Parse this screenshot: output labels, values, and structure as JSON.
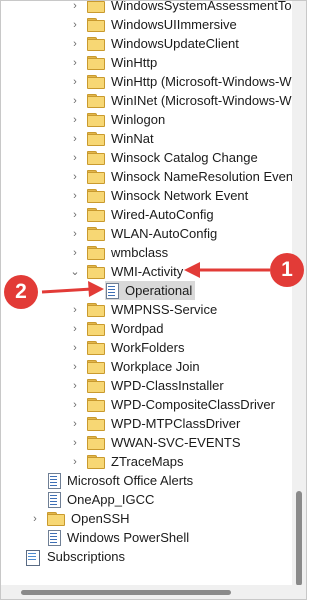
{
  "tree": {
    "items": [
      {
        "label": "WindowsSystemAssessmentTool",
        "icon": "folder-icon"
      },
      {
        "label": "WindowsUIImmersive",
        "icon": "folder-icon"
      },
      {
        "label": "WindowsUpdateClient",
        "icon": "folder-icon"
      },
      {
        "label": "WinHttp",
        "icon": "folder-icon"
      },
      {
        "label": "WinHttp (Microsoft-Windows-W",
        "icon": "folder-icon"
      },
      {
        "label": "WinINet (Microsoft-Windows-W",
        "icon": "folder-icon"
      },
      {
        "label": "Winlogon",
        "icon": "folder-icon"
      },
      {
        "label": "WinNat",
        "icon": "folder-icon"
      },
      {
        "label": "Winsock Catalog Change",
        "icon": "folder-icon"
      },
      {
        "label": "Winsock NameResolution Event",
        "icon": "folder-icon"
      },
      {
        "label": "Winsock Network Event",
        "icon": "folder-icon"
      },
      {
        "label": "Wired-AutoConfig",
        "icon": "folder-icon"
      },
      {
        "label": "WLAN-AutoConfig",
        "icon": "folder-icon"
      },
      {
        "label": "wmbclass",
        "icon": "folder-icon"
      },
      {
        "label": "WMI-Activity",
        "icon": "folder-icon",
        "expanded": true
      },
      {
        "label": "Operational",
        "icon": "log-icon",
        "selected": true
      },
      {
        "label": "WMPNSS-Service",
        "icon": "folder-icon"
      },
      {
        "label": "Wordpad",
        "icon": "folder-icon"
      },
      {
        "label": "WorkFolders",
        "icon": "folder-icon"
      },
      {
        "label": "Workplace Join",
        "icon": "folder-icon"
      },
      {
        "label": "WPD-ClassInstaller",
        "icon": "folder-icon"
      },
      {
        "label": "WPD-CompositeClassDriver",
        "icon": "folder-icon"
      },
      {
        "label": "WPD-MTPClassDriver",
        "icon": "folder-icon"
      },
      {
        "label": "WWAN-SVC-EVENTS",
        "icon": "folder-icon"
      },
      {
        "label": "ZTraceMaps",
        "icon": "folder-icon"
      },
      {
        "label": "Microsoft Office Alerts",
        "icon": "event-log-icon"
      },
      {
        "label": "OneApp_IGCC",
        "icon": "event-log-icon"
      },
      {
        "label": "OpenSSH",
        "icon": "folder-icon"
      },
      {
        "label": "Windows PowerShell",
        "icon": "event-log-icon"
      },
      {
        "label": "Subscriptions",
        "icon": "subscriptions-icon"
      }
    ]
  },
  "annotations": {
    "badge_1": "1",
    "badge_2": "2",
    "color": "#e23b37"
  }
}
